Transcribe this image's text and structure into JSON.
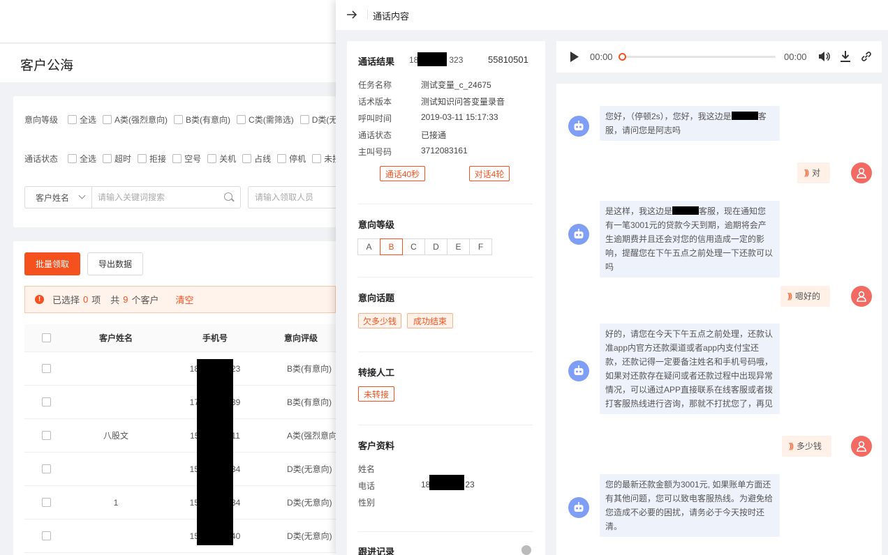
{
  "page": {
    "title": "客户公海",
    "filters": {
      "intent_label": "意向等级",
      "intent_options": [
        "全选",
        "A类(强烈意向)",
        "B类(有意向)",
        "C类(需筛选)",
        "D类(无"
      ],
      "status_label": "通话状态",
      "status_options": [
        "全选",
        "超时",
        "拒接",
        "空号",
        "关机",
        "占线",
        "停机",
        "未接"
      ],
      "search_field": "客户姓名",
      "search_placeholder": "请输入关键词搜索",
      "assignee_placeholder": "请输入领取人员"
    },
    "actions": {
      "batch_claim": "批量领取",
      "export": "导出数据"
    },
    "selection": {
      "prefix": "已选择",
      "selected": "0",
      "unit1": "项",
      "mid": "共",
      "total": "9",
      "unit2": "个客户",
      "clear": "清空"
    },
    "table": {
      "headers": [
        "客户姓名",
        "手机号",
        "意向评级"
      ],
      "rows": [
        {
          "name": "",
          "phone_a": "18",
          "phone_b": "23",
          "intent": "B类(有意向)"
        },
        {
          "name": "",
          "phone_a": "17",
          "phone_b": "39",
          "intent": "B类(有意向)"
        },
        {
          "name": "八股文",
          "phone_a": "15",
          "phone_b": "11",
          "intent": "A类(强烈意向"
        },
        {
          "name": "",
          "phone_a": "15",
          "phone_b": "34",
          "intent": "D类(无意向)"
        },
        {
          "name": "1",
          "phone_a": "15",
          "phone_b": "34",
          "intent": "D类(无意向)"
        },
        {
          "name": "",
          "phone_a": "15",
          "phone_b": "40",
          "intent": "D类(无意向)"
        }
      ]
    }
  },
  "panel": {
    "title": "通话内容",
    "result": {
      "title": "通话结果",
      "phone_a": "18",
      "phone_b": "323",
      "code": "55810501",
      "fields": [
        {
          "k": "任务名称",
          "v": "测试变量_c_24675"
        },
        {
          "k": "话术版本",
          "v": "测试知识问答变量录音"
        },
        {
          "k": "呼叫时间",
          "v": "2019-03-11 15:17:33"
        },
        {
          "k": "通话状态",
          "v": "已接通"
        },
        {
          "k": "主叫号码",
          "v": "3712083161"
        }
      ],
      "duration_tag": "通话40秒",
      "rounds_tag": "对话4轮"
    },
    "intent": {
      "title": "意向等级",
      "grades": [
        "A",
        "B",
        "C",
        "D",
        "E",
        "F"
      ],
      "selected_grade": "B"
    },
    "topics": {
      "title": "意向话题",
      "tags": [
        "欠多少钱",
        "成功结束"
      ]
    },
    "transfer": {
      "title": "转接人工",
      "tag": "未转接"
    },
    "customer": {
      "title": "客户资料",
      "name_label": "姓名",
      "phone_label": "电话",
      "phone_a": "18",
      "phone_b": "23",
      "gender_label": "性别"
    },
    "next_section": "跟进记录"
  },
  "audio": {
    "current": "00:00",
    "total": "00:00",
    "progress": 0
  },
  "chat": [
    {
      "role": "bot",
      "text_a": "您好，（停顿2s），您好，我这边是",
      "text_b": "客服，请问您是阿志吗"
    },
    {
      "role": "user",
      "text": "对"
    },
    {
      "role": "bot",
      "text_a": "是这样，我这边是",
      "text_b": "客服，现在通知您有一笔3001元的贷款今天到期，逾期将会产生逾期费并且还会对您的信用造成一定的影响，提醒您在下午五点之前处理一下还款可以吗"
    },
    {
      "role": "user",
      "text": "嗯好的"
    },
    {
      "role": "bot",
      "text": "好的，请您在今天下午五点之前处理，还款认准app内官方还款渠道或者app内支付宝还款，还款记得一定要备注姓名和手机号码哦，如果对还款存在疑问或者还款过程中出现异常情况，可以通过APP直接联系在线客服或者拨打客服热线进行咨询，那就不打扰您了，再见"
    },
    {
      "role": "user",
      "text": "多少钱"
    },
    {
      "role": "bot",
      "text": "您的最新还款金额为3001元, 如果账单方面还有其他问题，您可以致电客服热线。为避免给您造成不必要的困扰，请务必于今天按时还清。"
    }
  ]
}
